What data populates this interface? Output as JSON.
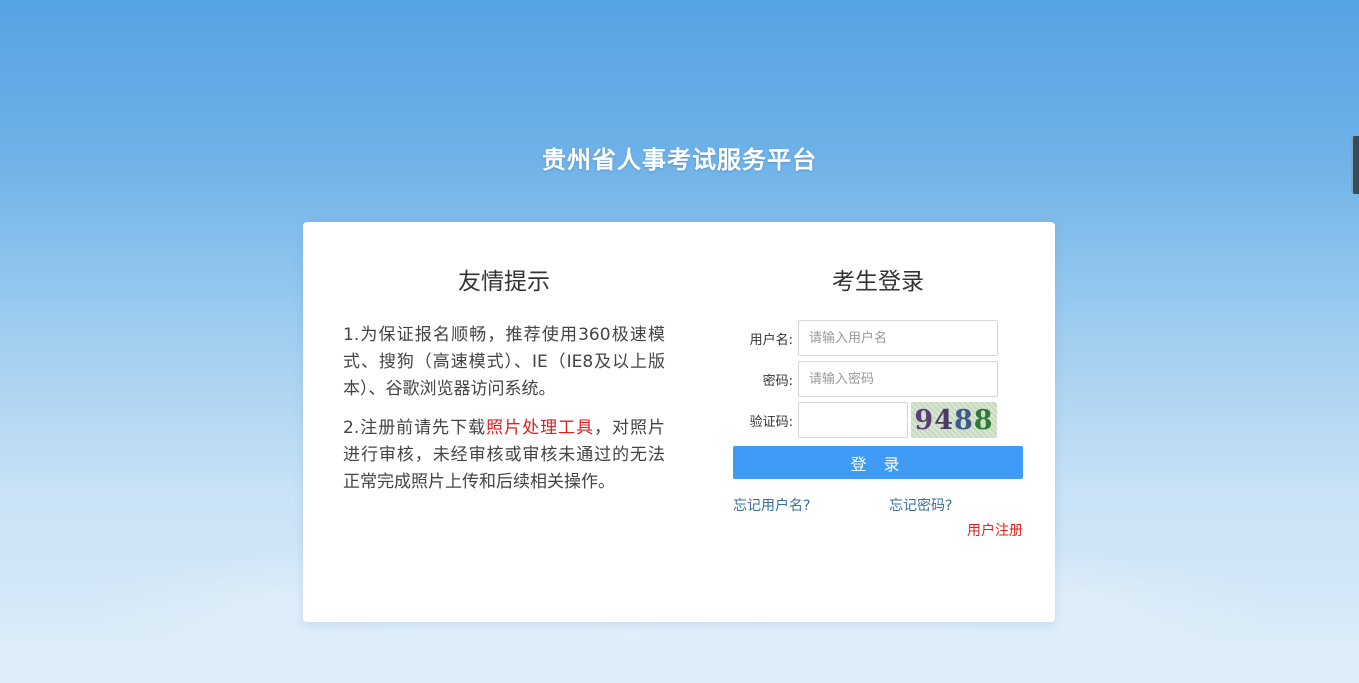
{
  "header": {
    "title": "贵州省人事考试服务平台"
  },
  "notice": {
    "title": "友情提示",
    "item1": "1.为保证报名顺畅，推荐使用360极速模式、搜狗（高速模式）、IE（IE8及以上版本）、谷歌浏览器访问系统。",
    "item2_before": "2.注册前请先下载",
    "item2_link": "照片处理工具",
    "item2_after": "，对照片进行审核，未经审核或审核未通过的无法正常完成照片上传和后续相关操作。"
  },
  "login": {
    "title": "考生登录",
    "username_label": "用户名:",
    "username_placeholder": "请输入用户名",
    "password_label": "密码:",
    "password_placeholder": "请输入密码",
    "captcha_label": "验证码:",
    "captcha_chars": [
      "9",
      "4",
      "8",
      "8"
    ],
    "submit_label": "登 录",
    "forgot_username": "忘记用户名?",
    "forgot_password": "忘记密码?",
    "register": "用户注册"
  },
  "colors": {
    "accent": "#3f9bf6",
    "link_red": "#e02020",
    "link_blue": "#3a6fa0"
  }
}
